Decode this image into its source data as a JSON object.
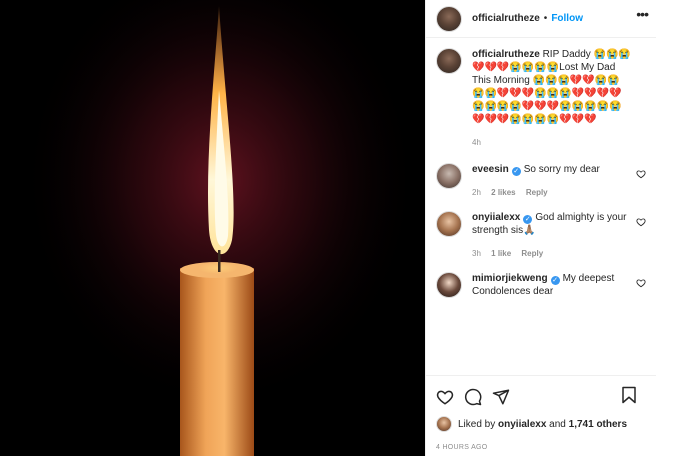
{
  "post": {
    "username": "officialrutheze",
    "follow_label": "Follow",
    "separator": "•",
    "more_label": "...",
    "caption": "RIP Daddy 😭😭😭💔💔💔😭😭😭😭Lost My Dad This Morning 😭😭😭💔💔😭😭😭😭💔💔💔😭😭😭💔💔💔💔😭😭😭😭💔💔💔😭😭😭😭😭💔💔💔😭😭😭😭💔💔💔",
    "caption_time": "4h"
  },
  "comments": [
    {
      "username": "eveesin",
      "verified": true,
      "text": "So sorry my dear",
      "time": "2h",
      "likes": "2 likes",
      "reply": "Reply"
    },
    {
      "username": "onyiialexx",
      "verified": true,
      "text": "God almighty is your strength sis🙏🏽",
      "time": "3h",
      "likes": "1 like",
      "reply": "Reply"
    },
    {
      "username": "mimiorjiekweng",
      "verified": true,
      "text": "My deepest Condolences dear",
      "time": "",
      "likes": "",
      "reply": ""
    }
  ],
  "footer": {
    "liked_prefix": "Liked by",
    "liked_user": "onyiialexx",
    "liked_and": "and",
    "liked_count": "1,741 others",
    "time_ago": "4 HOURS AGO"
  },
  "icons": {
    "like": "heart-icon",
    "comment": "comment-icon",
    "share": "send-icon",
    "save": "bookmark-icon",
    "badge": "verified-badge-icon"
  },
  "colors": {
    "accent": "#0095f6",
    "verified": "#3897f0",
    "secondary_text": "#8e8e8e",
    "candle_wax": "#e9953f",
    "flame": "#fff4c9"
  }
}
